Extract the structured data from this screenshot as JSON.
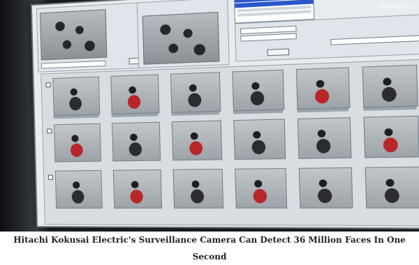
{
  "watermark": "diginfo.tv",
  "caption": "Hitachi Kokusai Electric's Surveillance Camera Can Detect 36 Million Faces In One Second"
}
